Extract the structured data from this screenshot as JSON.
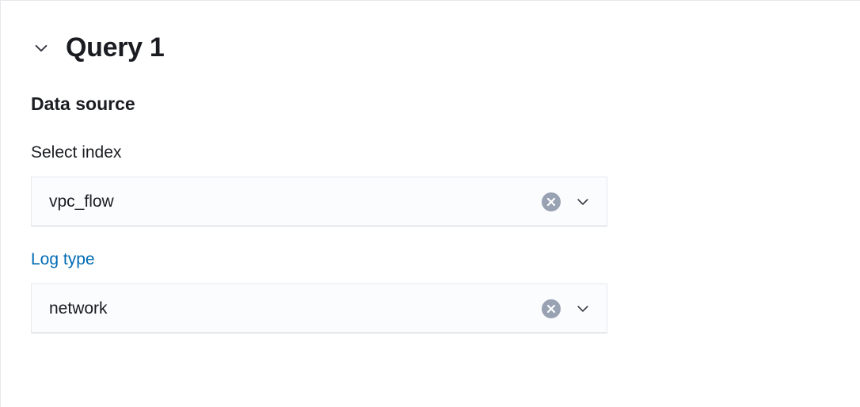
{
  "query": {
    "title": "Query 1",
    "section_title": "Data source",
    "fields": {
      "index": {
        "label": "Select index",
        "value": "vpc_flow"
      },
      "log_type": {
        "label": "Log type",
        "value": "network"
      }
    }
  },
  "icons": {
    "chevron_down": "chevron-down-icon",
    "clear": "clear-icon"
  },
  "colors": {
    "link": "#006bb4",
    "text": "#1a1c21",
    "muted_bg": "#fbfcfd",
    "border": "#e6e8ed",
    "clear_bg": "#98a2b3"
  }
}
